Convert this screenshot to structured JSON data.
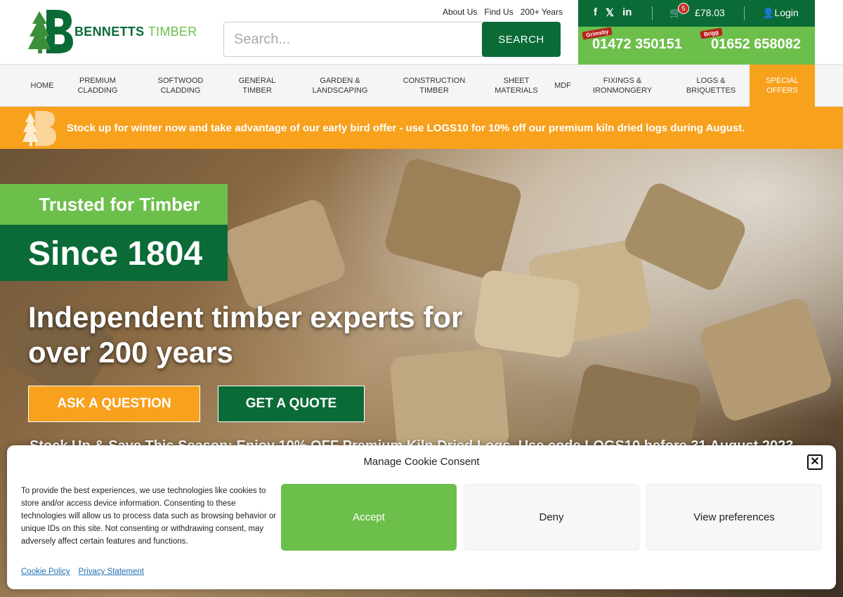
{
  "header": {
    "logo": {
      "name_bold": "BENNETTS",
      "name_light": "TIMBER"
    },
    "top_links": [
      "About Us",
      "Find Us",
      "200+ Years"
    ],
    "search": {
      "placeholder": "Search...",
      "button_label": "SEARCH"
    },
    "cart": {
      "count": "5",
      "total": "£78.03"
    },
    "login_label": "Login",
    "phones": [
      {
        "tag": "Grimsby",
        "number": "01472 350151"
      },
      {
        "tag": "Brigg",
        "number": "01652 658082"
      }
    ]
  },
  "nav": {
    "items": [
      {
        "label": "HOME"
      },
      {
        "label": "PREMIUM CLADDING"
      },
      {
        "label": "SOFTWOOD CLADDING"
      },
      {
        "label": "GENERAL TIMBER"
      },
      {
        "label": "GARDEN & LANDSCAPING"
      },
      {
        "label": "CONSTRUCTION TIMBER"
      },
      {
        "label": "SHEET MATERIALS"
      },
      {
        "label": "MDF"
      },
      {
        "label": "FIXINGS & IRONMONGERY"
      },
      {
        "label": "LOGS & BRIQUETTES"
      },
      {
        "label": "SPECIAL OFFERS"
      }
    ]
  },
  "banner": {
    "text": "Stock up for winter now and take advantage of our early bird offer - use LOGS10 for 10% off our premium kiln dried logs during August."
  },
  "hero": {
    "tag_line_1": "Trusted for Timber",
    "tag_line_2": "Since 1804",
    "headline": "Independent timber experts for over 200 years",
    "ask_label": "ASK A QUESTION",
    "quote_label": "GET A QUOTE",
    "ticker": "Stock Up & Save This Season: Enjoy 10% OFF Premium Kiln Dried Logs. Use code LOGS10 before 31 August 2023"
  },
  "cookie": {
    "title": "Manage Cookie Consent",
    "body": "To provide the best experiences, we use technologies like cookies to store and/or access device information. Consenting to these technologies will allow us to process data such as browsing behavior or unique IDs on this site. Not consenting or withdrawing consent, may adversely affect certain features and functions.",
    "accept_label": "Accept",
    "deny_label": "Deny",
    "view_label": "View preferences",
    "links": [
      "Cookie Policy",
      "Privacy Statement"
    ]
  },
  "colors": {
    "brand_green": "#0a6b37",
    "light_green": "#6cbf4b",
    "orange": "#f7a11d"
  }
}
